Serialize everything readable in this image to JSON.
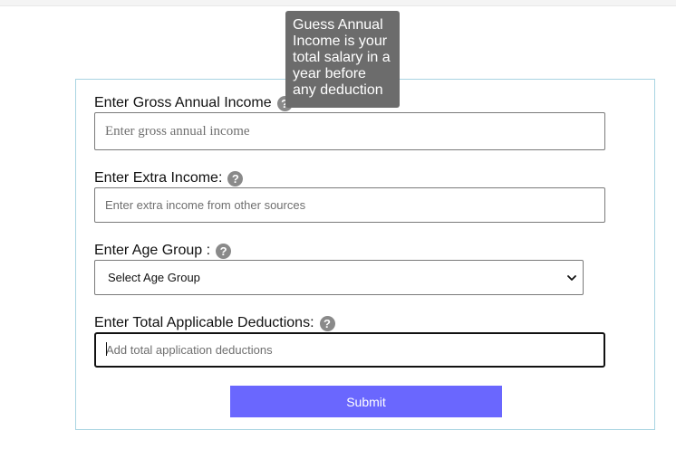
{
  "tooltip": {
    "text": "Guess Annual Income is your total salary in a year before any deduction"
  },
  "form": {
    "gross_income": {
      "label": "Enter Gross Annual Income",
      "placeholder": "Enter gross annual income",
      "value": ""
    },
    "extra_income": {
      "label": "Enter Extra Income:",
      "placeholder": "Enter extra income from other sources",
      "value": ""
    },
    "age_group": {
      "label": "Enter Age Group :",
      "selected": "Select Age Group"
    },
    "deductions": {
      "label": "Enter Total Applicable Deductions:",
      "placeholder": "Add total application deductions",
      "value": ""
    },
    "submit_label": "Submit",
    "help_glyph": "?"
  },
  "colors": {
    "submit_bg": "#6a67fe",
    "card_border": "#a9d4e2",
    "tooltip_bg": "#6c6c6c"
  }
}
